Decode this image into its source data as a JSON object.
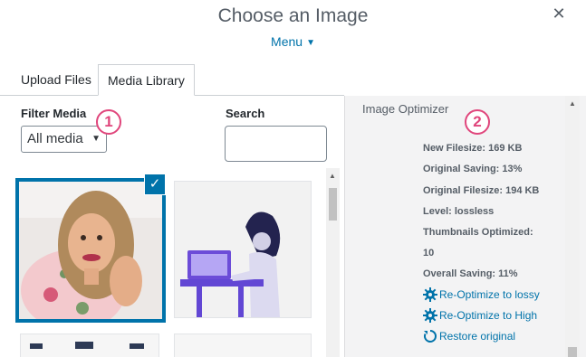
{
  "header": {
    "title": "Choose an Image",
    "menu_label": "Menu",
    "close_glyph": "✕"
  },
  "tabs": [
    {
      "label": "Upload Files",
      "active": false
    },
    {
      "label": "Media Library",
      "active": true
    }
  ],
  "filters": {
    "filter_label": "Filter Media",
    "filter_value": "All media",
    "search_label": "Search",
    "search_value": ""
  },
  "annotations": {
    "badge1": "1",
    "badge2": "2",
    "badge_color": "#e0467c"
  },
  "optimizer": {
    "title": "Image Optimizer",
    "new_filesize": "New Filesize: 169 KB",
    "original_saving": "Original Saving: 13%",
    "original_filesize": "Original Filesize: 194 KB",
    "level": "Level: lossless",
    "thumbnails_label": "Thumbnails Optimized:",
    "thumbnails_value": "10",
    "overall_saving": "Overall Saving: 11%",
    "links": [
      {
        "label": "Re-Optimize to lossy",
        "icon": "gear-icon"
      },
      {
        "label": "Re-Optimize to High",
        "icon": "gear-icon"
      },
      {
        "label": "Restore original",
        "icon": "restore-icon"
      }
    ]
  },
  "colors": {
    "accent": "#0073aa",
    "panel_bg": "#f3f3f4"
  }
}
